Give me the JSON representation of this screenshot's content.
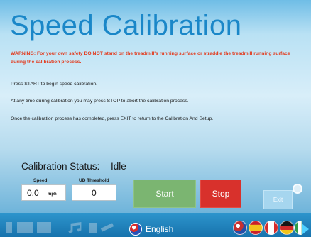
{
  "title": "Speed Calibration",
  "warning": "WARNING: For your own safety DO NOT stand on the treadmill's running surface or straddle the treadmill running surface during the calibration process.",
  "instructions": [
    "Press START to begin speed calibration.",
    "At any time during calibration you may press STOP to abort the calibration process.",
    "Once the calibration process has completed, press EXIT to return to the Calibration And Setup."
  ],
  "status": {
    "label": "Calibration Status:",
    "value": "Idle"
  },
  "speed": {
    "label": "Speed",
    "value": "0.0",
    "unit": "mph"
  },
  "threshold": {
    "label": "UD Threshold",
    "value": "0"
  },
  "buttons": {
    "start": "Start",
    "stop": "Stop",
    "exit": "Exit"
  },
  "taskbar": {
    "language": "English",
    "icons": [
      "usb-icon",
      "keyboard-icon",
      "screen-icon",
      "music-icon",
      "pen-icon",
      "tools-icon",
      "globe-icon",
      "usa-flag-icon",
      "spain-flag-icon",
      "canada-flag-icon",
      "germany-flag-icon",
      "italy-flag-icon",
      "next-arrow-icon"
    ]
  },
  "colors": {
    "title": "#1a87c8",
    "warning": "#e33a1d",
    "start": "#7bb571",
    "stop": "#d8312c",
    "exit": "#a6d6ef",
    "taskbar": "#1773ad"
  }
}
